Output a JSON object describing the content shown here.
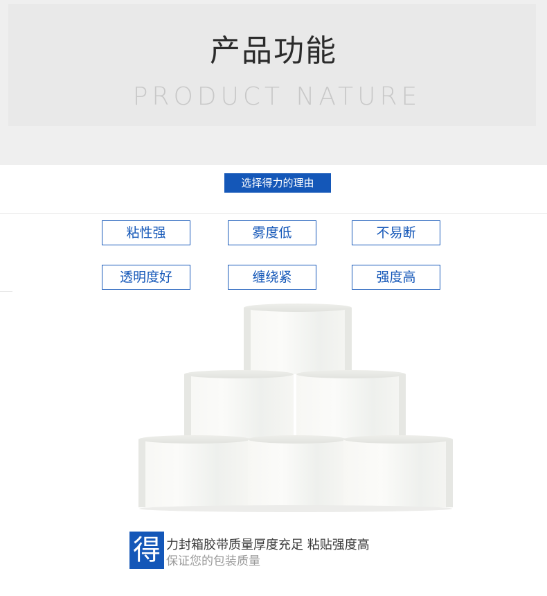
{
  "header": {
    "title_cn": "产品功能",
    "title_en": "PRODUCT NATURE"
  },
  "reason": {
    "label": "选择得力的理由"
  },
  "features": [
    {
      "label": "粘性强"
    },
    {
      "label": "雾度低"
    },
    {
      "label": "不易断"
    },
    {
      "label": "透明度好"
    },
    {
      "label": "缠绕紧"
    },
    {
      "label": "强度高"
    }
  ],
  "caption": {
    "icon_char": "得",
    "line1": "力封箱胶带质量厚度充足 粘贴强度高",
    "line2": "保证您的包装质量"
  },
  "colors": {
    "accent": "#1457b8",
    "header_bg": "#efefef",
    "title_text": "#2b2b2b",
    "subtitle_text": "#c8c8c8"
  },
  "icons": {
    "product_image": "tape-rolls-pyramid"
  }
}
